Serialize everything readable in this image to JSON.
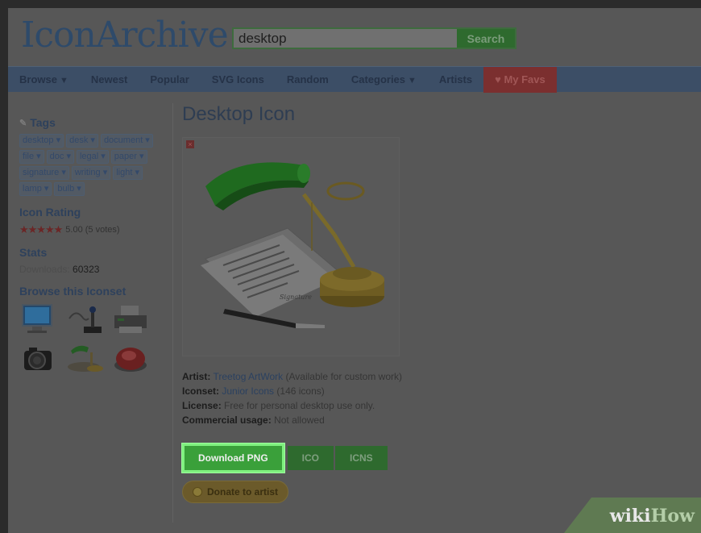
{
  "header": {
    "logo": "IconArchive",
    "search": {
      "value": "desktop",
      "button": "Search"
    }
  },
  "nav": {
    "items": [
      {
        "label": "Browse",
        "has_arrow": true
      },
      {
        "label": "Newest",
        "has_arrow": false
      },
      {
        "label": "Popular",
        "has_arrow": false
      },
      {
        "label": "SVG Icons",
        "has_arrow": false
      },
      {
        "label": "Random",
        "has_arrow": false
      },
      {
        "label": "Categories",
        "has_arrow": true
      },
      {
        "label": "Artists",
        "has_arrow": false
      }
    ],
    "favs": "♥ My Favs"
  },
  "sidebar": {
    "tags_title": "Tags",
    "tags": [
      "desktop",
      "desk",
      "document",
      "file",
      "doc",
      "legal",
      "paper",
      "signature",
      "writing",
      "light",
      "lamp",
      "bulb"
    ],
    "rating_title": "Icon Rating",
    "stars": "★★★★★",
    "rating_text": "5.00 (5 votes)",
    "stats_title": "Stats",
    "downloads_label": "Downloads:",
    "downloads_value": "60323",
    "browse_title": "Browse this Iconset",
    "thumbs": [
      "monitor-icon",
      "joystick-icon",
      "printer-icon",
      "camera-icon",
      "banker-lamp-icon",
      "help-button-icon"
    ]
  },
  "main": {
    "title": "Desktop Icon",
    "artist_label": "Artist:",
    "artist_link": "Treetog ArtWork",
    "artist_note": "(Available for custom work)",
    "iconset_label": "Iconset:",
    "iconset_link": "Junior Icons",
    "iconset_count": "(146 icons)",
    "license_label": "License:",
    "license_value": "Free for personal desktop use only.",
    "commercial_label": "Commercial usage:",
    "commercial_value": "Not allowed",
    "download_png": "Download PNG",
    "download_ico": "ICO",
    "download_icns": "ICNS",
    "donate": "Donate to artist"
  },
  "watermark": {
    "wiki": "wiki",
    "how": "How"
  },
  "colors": {
    "highlight_green": "#3aa03a",
    "highlight_border": "#7ff07f",
    "nav_bg": "#3c4e66",
    "favs_red": "#7b2f2f"
  }
}
